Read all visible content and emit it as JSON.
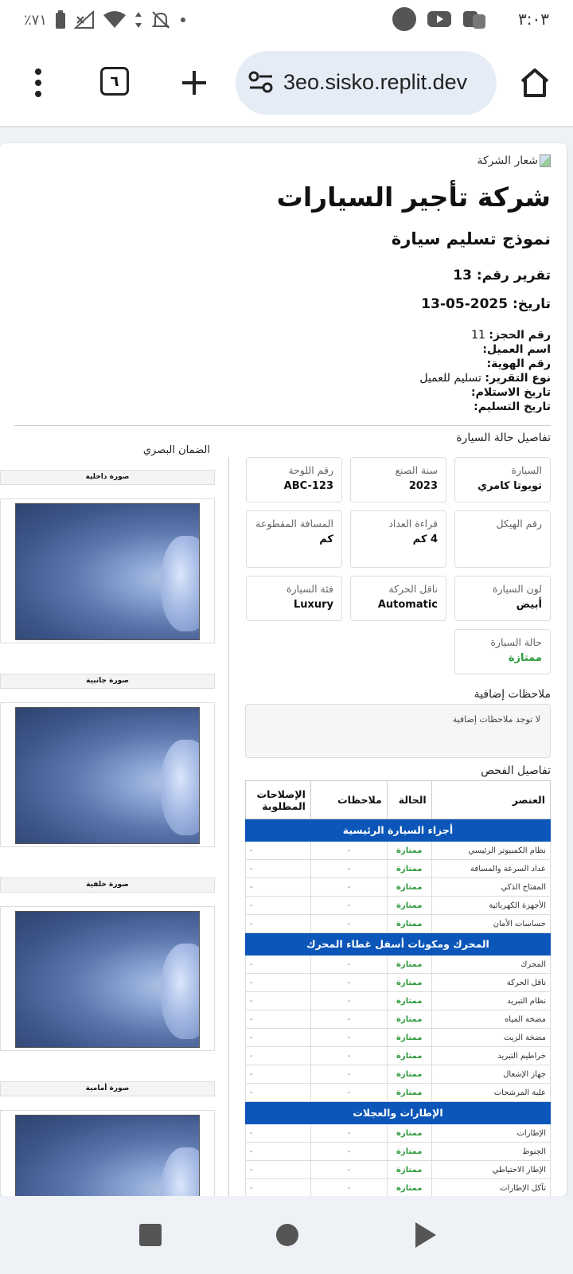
{
  "status_bar": {
    "time": "٣:٠٣",
    "battery": "٪٧١"
  },
  "browser": {
    "url": "3eo.sisko.replit.dev",
    "tabs_count": "٦"
  },
  "report": {
    "logo_alt": "شعار الشركة",
    "company_name": "شركة تأجير السيارات",
    "form_title": "نموذج تسليم سيارة",
    "report_number": "تقرير رقم: 13",
    "date": "تاريخ: 2025-05-13",
    "meta": [
      {
        "label": "رقم الحجز:",
        "value": "11"
      },
      {
        "label": "اسم العميل:",
        "value": ""
      },
      {
        "label": "رقم الهوية:",
        "value": ""
      },
      {
        "label": "نوع التقرير:",
        "value": "تسليم للعميل"
      },
      {
        "label": "تاريخ الاستلام:",
        "value": ""
      },
      {
        "label": "تاريخ التسليم:",
        "value": ""
      }
    ]
  },
  "details": {
    "title": "تفاصيل حالة السيارة",
    "cards": [
      {
        "label": "السيارة",
        "value": "تويوتا كامري"
      },
      {
        "label": "سنة الصنع",
        "value": "2023"
      },
      {
        "label": "رقم اللوحة",
        "value": "ABC-123"
      },
      {
        "label": "رقم الهيكل",
        "value": ""
      },
      {
        "label": "قراءة العداد",
        "value": "4 كم"
      },
      {
        "label": "المسافة المقطوعة",
        "value": "كم"
      },
      {
        "label": "لون السيارة",
        "value": "أبيض"
      },
      {
        "label": "ناقل الحركة",
        "value": "Automatic"
      },
      {
        "label": "فئة السيارة",
        "value": "Luxury"
      },
      {
        "label": "حالة السيارة",
        "value": "ممتازة"
      }
    ]
  },
  "notes": {
    "title": "ملاحظات إضافية",
    "text": "لا توجد ملاحظات إضافية"
  },
  "inspection": {
    "title": "تفاصيل الفحص",
    "headers": [
      "العنصر",
      "الحالة",
      "ملاحظات",
      "الإصلاحات المطلوبة"
    ],
    "sections": [
      {
        "name": "أجزاء السيارة الرئيسية",
        "rows": [
          {
            "item": "نظام الكمبيوتر الرئيسي",
            "status": "ممتازة",
            "notes": "-",
            "repairs": "-"
          },
          {
            "item": "عداد السرعة والمسافة",
            "status": "ممتازة",
            "notes": "-",
            "repairs": "-"
          },
          {
            "item": "المفتاح الذكي",
            "status": "ممتازة",
            "notes": "-",
            "repairs": "-"
          },
          {
            "item": "الأجهزة الكهربائية",
            "status": "ممتازة",
            "notes": "-",
            "repairs": "-"
          },
          {
            "item": "حساسات الأمان",
            "status": "ممتازة",
            "notes": "-",
            "repairs": "-"
          }
        ]
      },
      {
        "name": "المحرك ومكونات أسفل غطاء المحرك",
        "rows": [
          {
            "item": "المحرك",
            "status": "ممتازة",
            "notes": "-",
            "repairs": "-"
          },
          {
            "item": "ناقل الحركة",
            "status": "ممتازة",
            "notes": "-",
            "repairs": "-"
          },
          {
            "item": "نظام التبريد",
            "status": "ممتازة",
            "notes": "-",
            "repairs": "-"
          },
          {
            "item": "مضخة المياه",
            "status": "ممتازة",
            "notes": "-",
            "repairs": "-"
          },
          {
            "item": "مضخة الزيت",
            "status": "ممتازة",
            "notes": "-",
            "repairs": "-"
          },
          {
            "item": "خراطيم التبريد",
            "status": "ممتازة",
            "notes": "-",
            "repairs": "-"
          },
          {
            "item": "جهاز الإشعال",
            "status": "ممتازة",
            "notes": "-",
            "repairs": "-"
          },
          {
            "item": "علبة المرشحات",
            "status": "ممتازة",
            "notes": "-",
            "repairs": "-"
          }
        ]
      },
      {
        "name": "الإطارات والعجلات",
        "rows": [
          {
            "item": "الإطارات",
            "status": "ممتازة",
            "notes": "-",
            "repairs": "-"
          },
          {
            "item": "الجنوط",
            "status": "ممتازة",
            "notes": "-",
            "repairs": "-"
          },
          {
            "item": "الإطار الاحتياطي",
            "status": "ممتازة",
            "notes": "-",
            "repairs": "-"
          },
          {
            "item": "تآكل الإطارات",
            "status": "ممتازة",
            "notes": "-",
            "repairs": "-"
          }
        ]
      }
    ]
  },
  "visual_warranty": {
    "title": "الضمان البصري",
    "photos": [
      {
        "label": "صورة داخلية"
      },
      {
        "label": "صورة جانبية"
      },
      {
        "label": "صورة خلفية"
      },
      {
        "label": "صورة أمامية"
      }
    ]
  },
  "colors": {
    "accent": "#0b56b8",
    "good_status": "#2c9a3c"
  }
}
